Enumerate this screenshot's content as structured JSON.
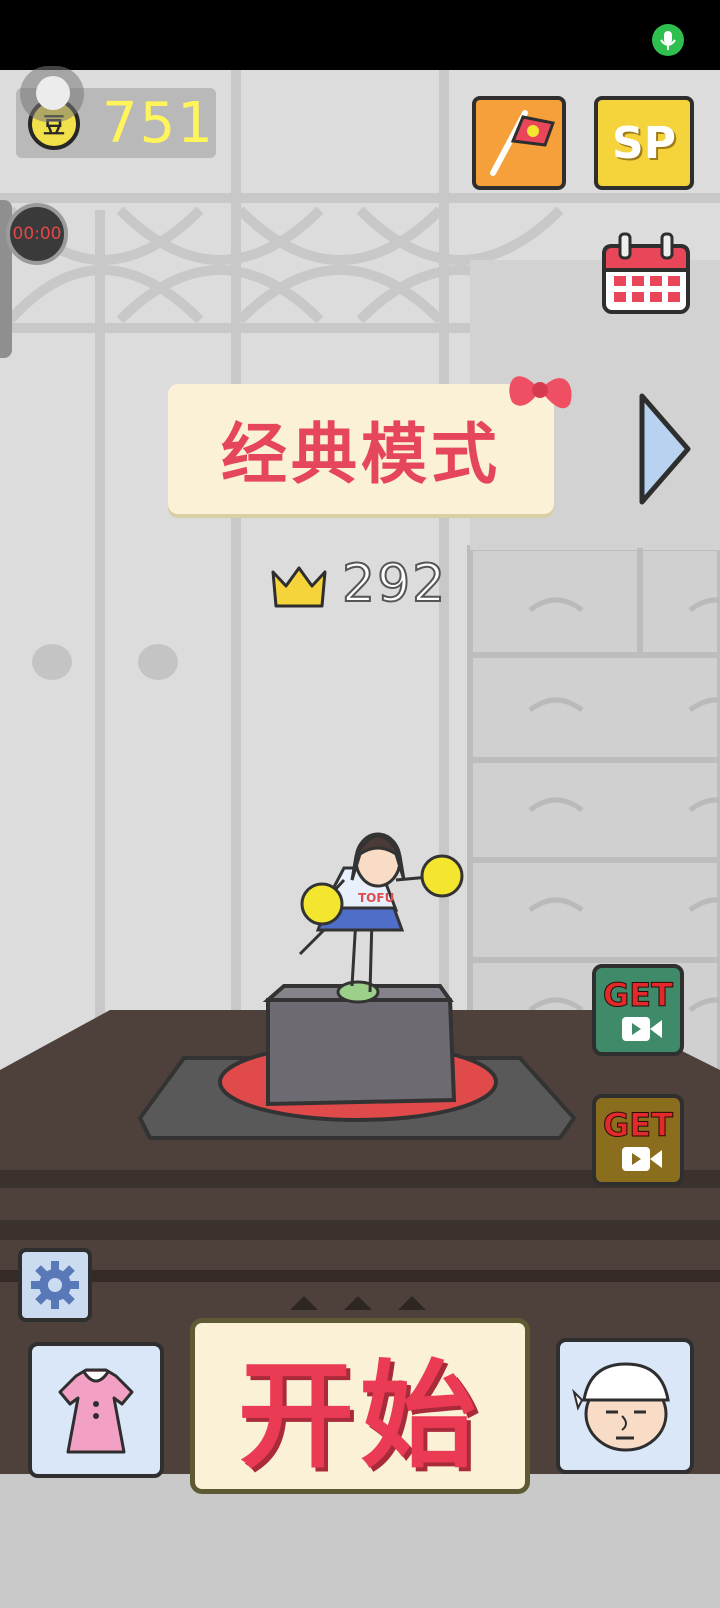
{
  "status_bar": {
    "mic_icon": "microphone-icon"
  },
  "coins": {
    "icon": "coin-icon",
    "icon_glyph": "豆",
    "count": "751"
  },
  "timer": {
    "value": "00:00"
  },
  "top_buttons": {
    "flag_icon": "flag-icon",
    "sp_label": "SP",
    "calendar_icon": "calendar-icon"
  },
  "mode": {
    "title": "经典模式",
    "next_icon": "chevron-right-icon"
  },
  "best": {
    "crown_icon": "crown-icon",
    "score": "292"
  },
  "rewards": [
    {
      "label": "GET",
      "icon": "video-camera-icon"
    },
    {
      "label": "GET",
      "icon": "video-camera-icon"
    }
  ],
  "bottom": {
    "settings_icon": "gear-icon",
    "wardrobe_icon": "dress-icon",
    "start_label": "开始",
    "chef_icon": "chef-face-icon"
  },
  "character": {
    "shirt_text": "TOFU"
  },
  "colors": {
    "accent_red": "#e5465a",
    "coin_yellow": "#fff55a",
    "banner_cream": "#faf1d6",
    "table_brown": "#4e413c"
  }
}
